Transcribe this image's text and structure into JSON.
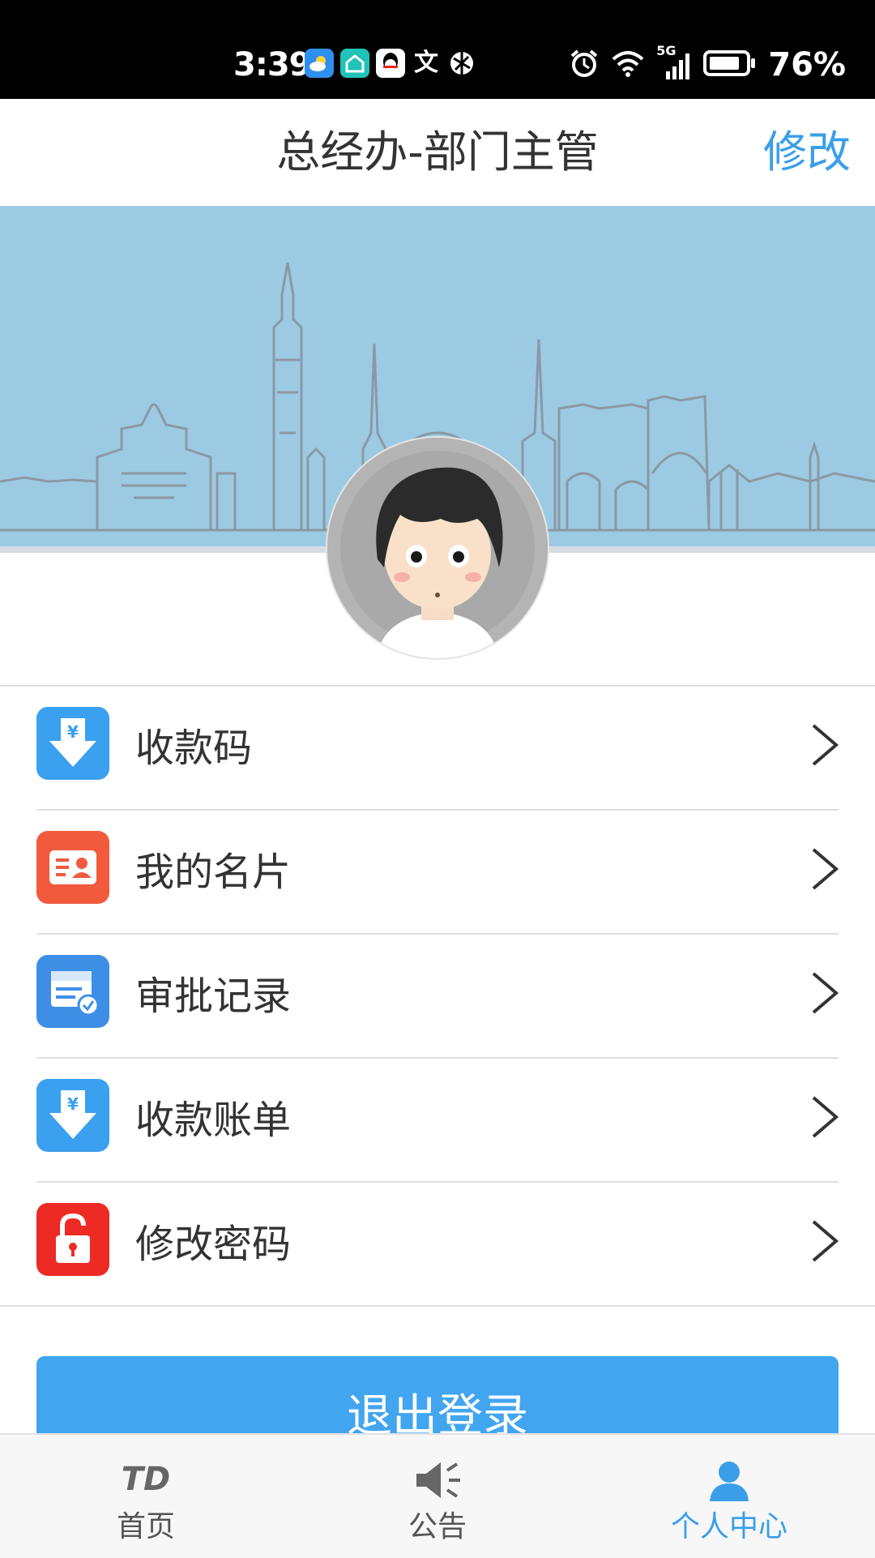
{
  "status_bar": {
    "time": "3:39",
    "battery": "76%",
    "network": "5G",
    "app_icons": [
      "weather-icon",
      "home-app-icon",
      "qq-icon",
      "text-input-icon",
      "browser-icon"
    ]
  },
  "header": {
    "title": "总经办-部门主管",
    "edit_label": "修改"
  },
  "menu": {
    "items": [
      {
        "label": "收款码",
        "icon": "receive-money-icon",
        "color": "#3ba0f0"
      },
      {
        "label": "我的名片",
        "icon": "business-card-icon",
        "color": "#f15a3d"
      },
      {
        "label": "审批记录",
        "icon": "approval-record-icon",
        "color": "#3d8fe6"
      },
      {
        "label": "收款账单",
        "icon": "receive-bill-icon",
        "color": "#3ba0f0"
      },
      {
        "label": "修改密码",
        "icon": "lock-icon",
        "color": "#ee2a25"
      }
    ]
  },
  "logout": {
    "label": "退出登录"
  },
  "tab_bar": {
    "tabs": [
      {
        "label": "首页",
        "icon": "td-logo-icon",
        "active": false
      },
      {
        "label": "公告",
        "icon": "megaphone-icon",
        "active": false
      },
      {
        "label": "个人中心",
        "icon": "person-icon",
        "active": true
      }
    ]
  },
  "colors": {
    "accent": "#3a9fe8",
    "banner": "#9ccae3",
    "logout_button": "#42a5f0",
    "tab_active": "#3a9fe8",
    "tab_inactive": "#555555"
  }
}
